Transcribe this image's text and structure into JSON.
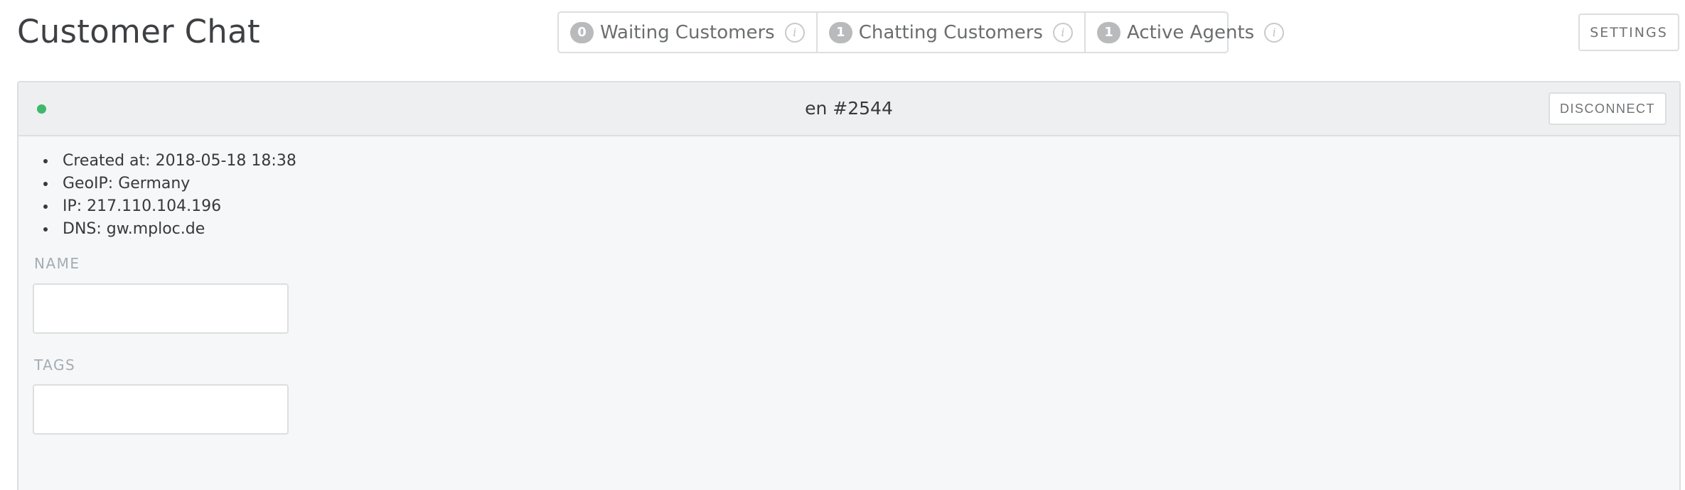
{
  "header": {
    "title": "Customer Chat",
    "settings_label": "SETTINGS"
  },
  "stats": [
    {
      "count": "0",
      "label": "Waiting Customers"
    },
    {
      "count": "1",
      "label": "Chatting Customers"
    },
    {
      "count": "1",
      "label": "Active Agents"
    }
  ],
  "chat": {
    "title": "en #2544",
    "status_color": "#3fb86b",
    "disconnect_label": "DISCONNECT",
    "info": [
      "Created at: 2018-05-18 18:38",
      "GeoIP: Germany",
      "IP: 217.110.104.196",
      "DNS: gw.mploc.de"
    ],
    "name_label": "NAME",
    "name_value": "",
    "tags_label": "TAGS",
    "tags_value": ""
  }
}
